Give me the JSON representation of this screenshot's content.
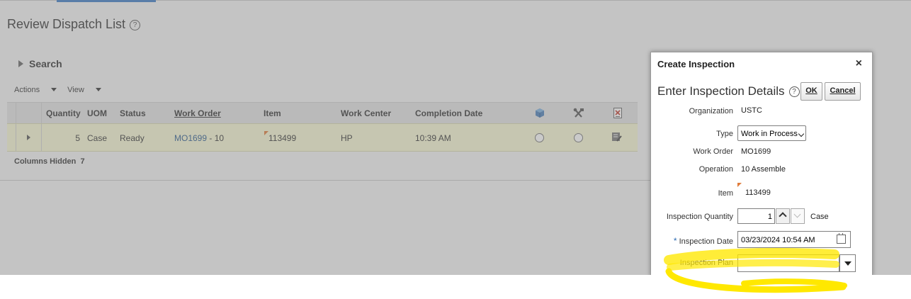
{
  "page": {
    "title": "Review Dispatch List",
    "search_label": "Search",
    "toolbar": {
      "actions": "Actions",
      "view": "View"
    },
    "columns_hidden_label": "Columns Hidden",
    "columns_hidden_count": "7"
  },
  "table": {
    "headers": {
      "quantity": "Quantity",
      "uom": "UOM",
      "status": "Status",
      "work_order": "Work Order",
      "item": "Item",
      "work_center": "Work Center",
      "completion_date": "Completion Date"
    },
    "icons": [
      "cube-icon",
      "tools-icon",
      "report-icon"
    ],
    "rows": [
      {
        "quantity": "5",
        "uom": "Case",
        "status": "Ready",
        "work_order_link": "MO1699",
        "work_order_suffix": " - 10",
        "item": "113499",
        "work_center": "HP",
        "completion_date": "10:39 AM"
      }
    ]
  },
  "dialog": {
    "title": "Create Inspection",
    "close": "×",
    "heading": "Enter Inspection Details",
    "ok_label": "OK",
    "cancel_label": "Cancel",
    "fields": {
      "organization_label": "Organization",
      "organization_value": "USTC",
      "type_label": "Type",
      "type_value": "Work in Process",
      "work_order_label": "Work Order",
      "work_order_value": "MO1699",
      "operation_label": "Operation",
      "operation_value": "10 Assemble",
      "item_label": "Item",
      "item_value": "113499",
      "quantity_label": "Inspection Quantity",
      "quantity_value": "1",
      "quantity_uom": "Case",
      "date_label": "Inspection Date",
      "date_required": "*",
      "date_value": "03/23/2024 10:54 AM",
      "plan_label": "Inspection Plan",
      "plan_value": ""
    }
  },
  "colors": {
    "highlight": "#ffe800",
    "link": "#2c5b8f",
    "row_selected": "#f8f8d4"
  }
}
